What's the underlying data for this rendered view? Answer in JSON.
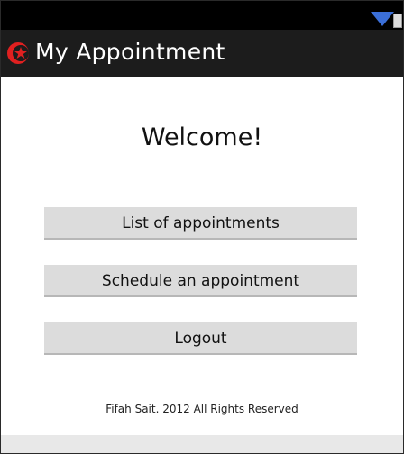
{
  "status_bar": {
    "icons": [
      "signal-icon",
      "battery-icon"
    ]
  },
  "action_bar": {
    "icon": "app-logo-icon",
    "title": "My Appointment"
  },
  "main": {
    "welcome": "Welcome!",
    "buttons": {
      "list": "List of appointments",
      "schedule": "Schedule an appointment",
      "logout": "Logout"
    },
    "footer": "Fifah Sait. 2012 All Rights Reserved"
  },
  "colors": {
    "action_bar_bg": "#1c1c1c",
    "button_bg": "#dcdcdc",
    "logo_red": "#e02020",
    "signal_blue": "#3b6fd8"
  }
}
